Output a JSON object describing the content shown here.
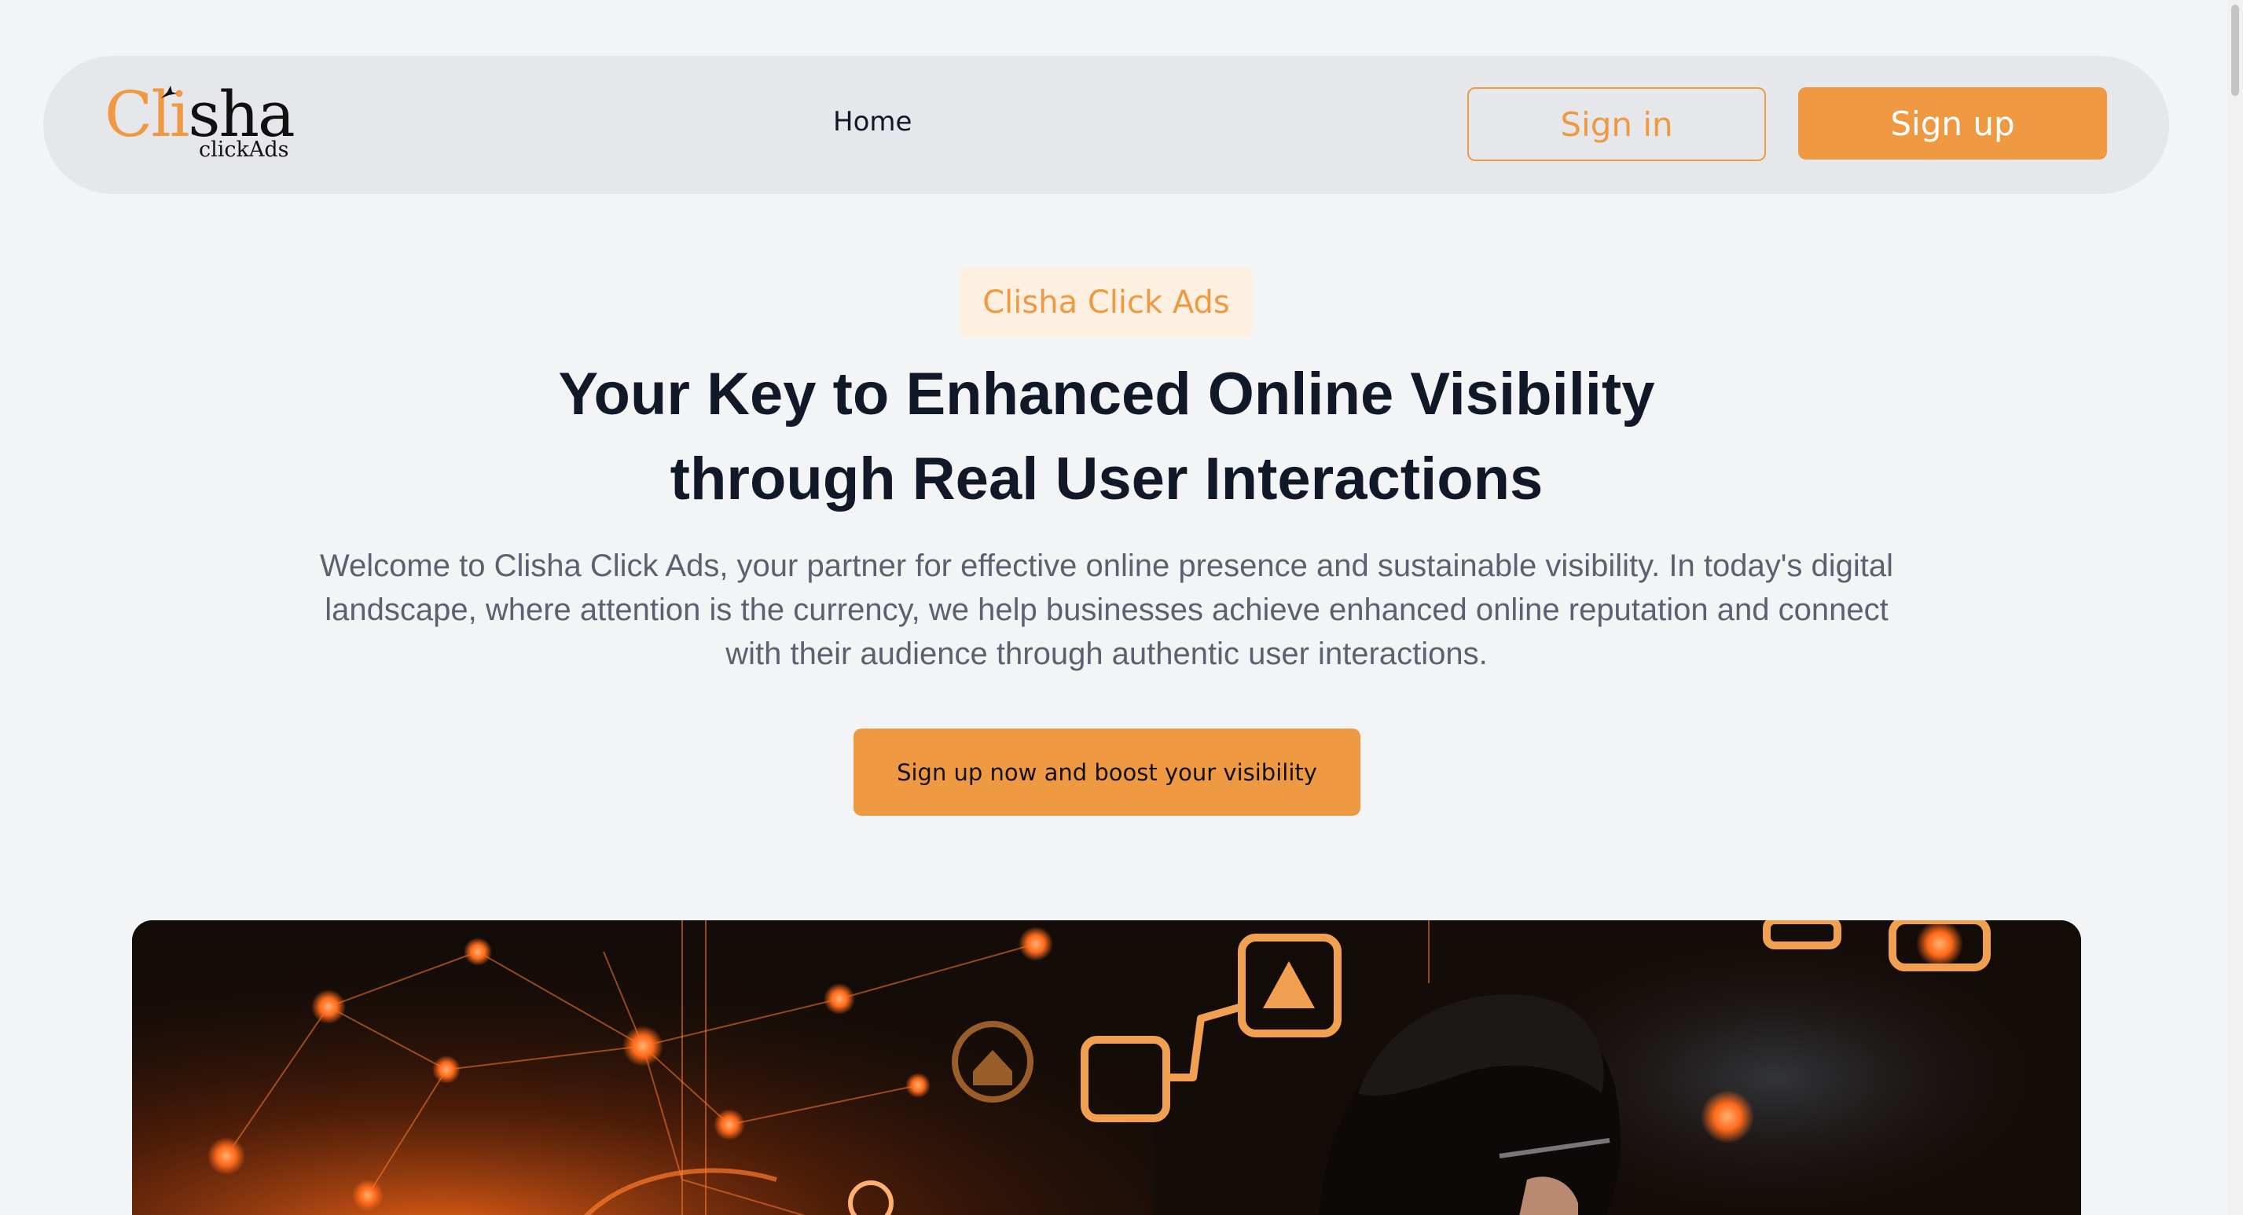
{
  "header": {
    "logo_text_accent": "Cli",
    "logo_text_rest": "sha",
    "logo_subtext": "clickAds",
    "nav": [
      {
        "label": "Home"
      }
    ],
    "signin_label": "Sign in",
    "signup_label": "Sign up"
  },
  "hero": {
    "badge": "Clisha Click Ads",
    "title_line1": "Your Key to Enhanced Online Visibility",
    "title_line2": "through Real User Interactions",
    "description": "Welcome to Clisha Click Ads, your partner for effective online presence and sustainable visibility. In today's digital landscape, where attention is the currency, we help businesses achieve enhanced online reputation and connect with their audience through authentic user interactions.",
    "cta_label": "Sign up now and boost your visibility"
  },
  "colors": {
    "accent": "#ef9a42",
    "page_background": "#f3f4f6",
    "navbar_background": "#e5e7eb",
    "badge_background": "#fdf0e0",
    "heading": "#111827",
    "body_text": "#5b6170"
  },
  "icons": {
    "logo_mark": "bird-icon",
    "hero_overlay_icons": [
      "triangle-warning-icon",
      "home-icon",
      "square-icon"
    ]
  }
}
